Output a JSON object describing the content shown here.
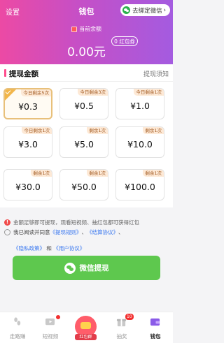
{
  "header": {
    "settings": "设置",
    "title": "钱包",
    "bind_wechat": "去绑定微信",
    "bind_arrow": "›",
    "balance_label": "当前余额",
    "balance": "0.00元",
    "coupon": "0 红包券"
  },
  "withdraw": {
    "title": "提现金额",
    "notice": "提现须知",
    "options": [
      {
        "amount": "¥0.3",
        "tag": "今日剩余5次",
        "selected": true
      },
      {
        "amount": "¥0.5",
        "tag": "今日剩余3次",
        "selected": false
      },
      {
        "amount": "¥1.0",
        "tag": "今日剩余1次",
        "selected": false
      },
      {
        "amount": "¥3.0",
        "tag": "今日剩余1次",
        "selected": false
      },
      {
        "amount": "¥5.0",
        "tag": "剩余1次",
        "selected": false
      },
      {
        "amount": "¥10.0",
        "tag": "剩余1次",
        "selected": false
      },
      {
        "amount": "¥30.0",
        "tag": "剩余1次",
        "selected": false
      },
      {
        "amount": "¥50.0",
        "tag": "剩余1次",
        "selected": false
      },
      {
        "amount": "¥100.0",
        "tag": "剩余1次",
        "selected": false
      }
    ]
  },
  "notes": {
    "warning_icon": "!",
    "warning": "金额足够即可提现，观看短视频、抽红包都可获得红包",
    "agree_prefix": "我已阅读并同意",
    "link1": "《提现规则》",
    "sep1": "、",
    "link2": "《结算协议》",
    "sep2": "、",
    "link3": "《隐私政策》",
    "and": "和",
    "link4": "《用户协议》"
  },
  "button": {
    "label": "微信提现"
  },
  "nav": {
    "items": [
      {
        "label": "走路赚",
        "icon": "walk-icon"
      },
      {
        "label": "短视频",
        "icon": "video-icon"
      },
      {
        "label": "红包群",
        "icon": "red-packet-icon"
      },
      {
        "label": "抽奖",
        "icon": "lottery-icon",
        "badge": "10"
      },
      {
        "label": "钱包",
        "icon": "wallet-icon"
      }
    ]
  },
  "colors": {
    "accent": "#ec4aa4",
    "primary_btn": "#5ec84e",
    "link": "#3a78f0",
    "tag_bg": "#fde9d6"
  }
}
